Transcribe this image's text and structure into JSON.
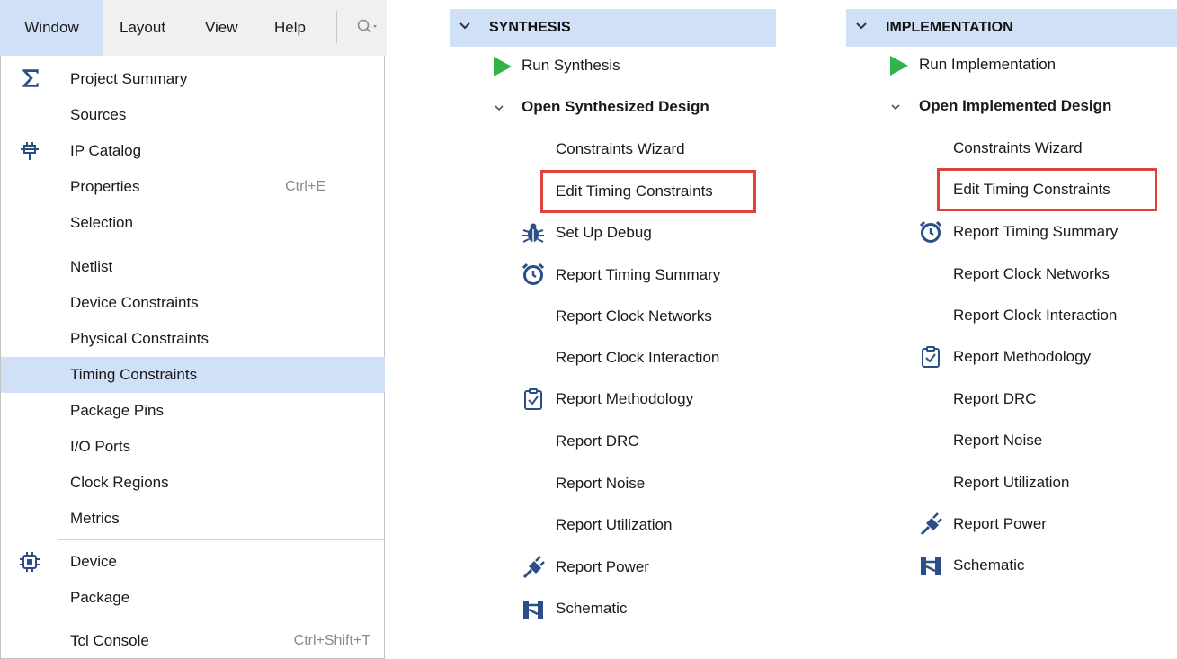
{
  "menubar": {
    "items": [
      "Window",
      "Layout",
      "View",
      "Help"
    ],
    "search_icon": "search-dropdown-icon"
  },
  "window_menu": {
    "items": [
      {
        "label": "Project Summary",
        "icon": "sigma-icon"
      },
      {
        "label": "Sources"
      },
      {
        "label": "IP Catalog",
        "icon": "plug-icon"
      },
      {
        "label": "Properties",
        "shortcut": "Ctrl+E"
      },
      {
        "label": "Selection"
      },
      {
        "label": "Netlist"
      },
      {
        "label": "Device Constraints"
      },
      {
        "label": "Physical Constraints"
      },
      {
        "label": "Timing Constraints",
        "selected": true
      },
      {
        "label": "Package Pins"
      },
      {
        "label": "I/O Ports"
      },
      {
        "label": "Clock Regions"
      },
      {
        "label": "Metrics"
      },
      {
        "label": "Device",
        "icon": "chip-icon"
      },
      {
        "label": "Package"
      },
      {
        "label": "Tcl Console",
        "shortcut": "Ctrl+Shift+T"
      }
    ]
  },
  "synthesis": {
    "header": "SYNTHESIS",
    "run": "Run Synthesis",
    "open": "Open Synthesized Design",
    "items": [
      "Constraints Wizard",
      "Edit Timing Constraints",
      "Set Up Debug",
      "Report Timing Summary",
      "Report Clock Networks",
      "Report Clock Interaction",
      "Report Methodology",
      "Report DRC",
      "Report Noise",
      "Report Utilization"
    ],
    "power": "Report Power",
    "schematic": "Schematic"
  },
  "implementation": {
    "header": "IMPLEMENTATION",
    "run": "Run Implementation",
    "open": "Open Implemented Design",
    "items": [
      "Constraints Wizard",
      "Edit Timing Constraints",
      "Report Timing Summary",
      "Report Clock Networks",
      "Report Clock Interaction",
      "Report Methodology",
      "Report DRC",
      "Report Noise",
      "Report Utilization"
    ],
    "power": "Report Power",
    "schematic": "Schematic"
  },
  "colors": {
    "header_bg": "#cfe0f7",
    "selection_bg": "#cfe0f7",
    "highlight_box": "#e0413d",
    "run_icon": "#2fb34a",
    "icon_blue": "#2a4f86"
  }
}
